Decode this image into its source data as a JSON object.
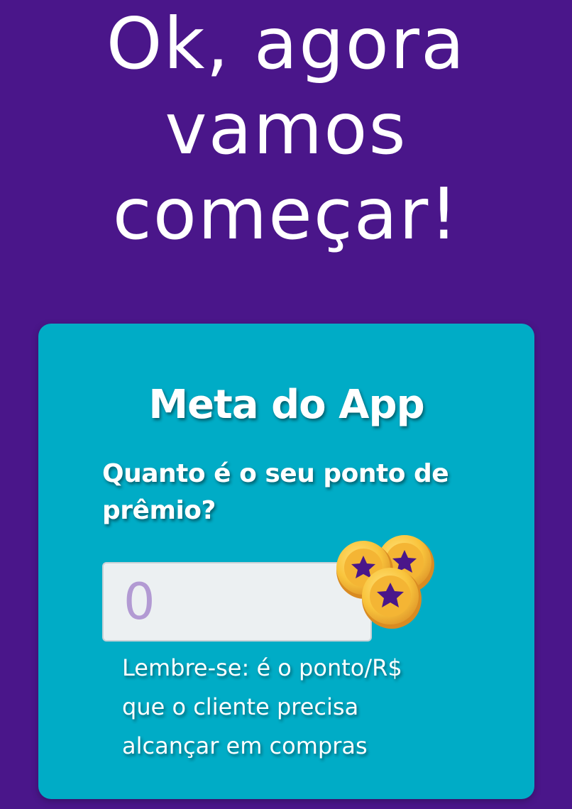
{
  "headline": {
    "lines": [
      "Ok, agora",
      "vamos",
      "começar!"
    ]
  },
  "card": {
    "title": "Meta do App",
    "question": "Quanto é o seu ponto de prêmio?",
    "input": {
      "placeholder": "0",
      "value": ""
    },
    "coins_icon": "coins-icon",
    "hint_lines": [
      "Lembre-se: é o ponto/R$",
      "que o cliente precisa",
      "alcançar em compras"
    ]
  },
  "colors": {
    "background": "#4a168a",
    "card": "#00acc6",
    "input_bg": "#ecf0f2",
    "placeholder": "#b29ad3",
    "coin_gold": "#f9c43c",
    "coin_star": "#4a168a"
  }
}
